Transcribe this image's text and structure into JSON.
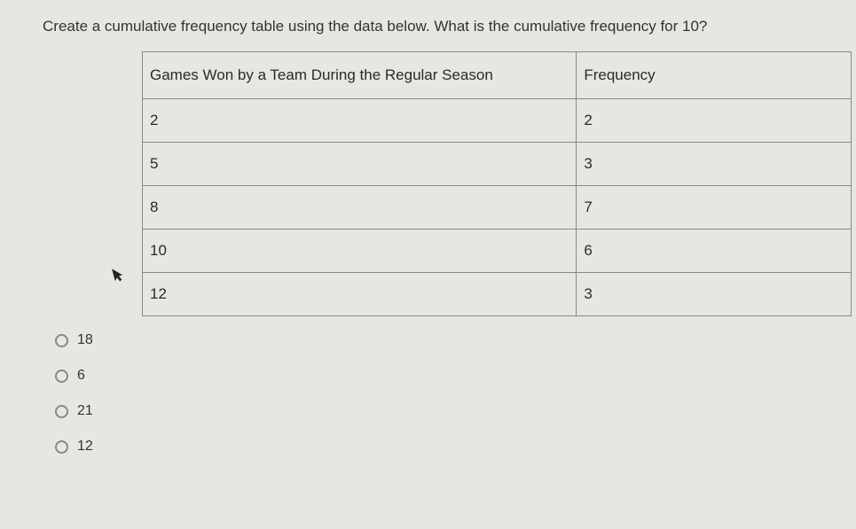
{
  "question": "Create a cumulative frequency table using the data below. What is the cumulative frequency for 10?",
  "table": {
    "headers": {
      "col1": "Games Won by a Team During the Regular Season",
      "col2": "Frequency"
    },
    "rows": [
      {
        "games": "2",
        "frequency": "2"
      },
      {
        "games": "5",
        "frequency": "3"
      },
      {
        "games": "8",
        "frequency": "7"
      },
      {
        "games": "10",
        "frequency": "6"
      },
      {
        "games": "12",
        "frequency": "3"
      }
    ]
  },
  "options": [
    {
      "label": "18"
    },
    {
      "label": "6"
    },
    {
      "label": "21"
    },
    {
      "label": "12"
    }
  ],
  "chart_data": {
    "type": "table",
    "title": "Frequency table: Games Won by a Team During the Regular Season",
    "categories": [
      "2",
      "5",
      "8",
      "10",
      "12"
    ],
    "series": [
      {
        "name": "Frequency",
        "values": [
          2,
          3,
          7,
          6,
          3
        ]
      }
    ]
  }
}
